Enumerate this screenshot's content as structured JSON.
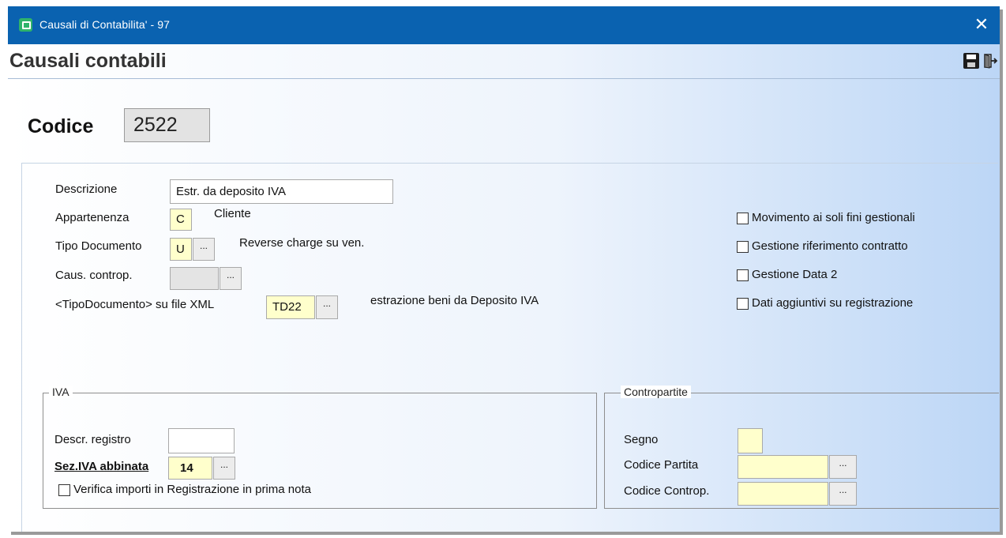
{
  "window": {
    "title": "Causali di Contabilita' - 97",
    "close_symbol": "✕"
  },
  "page": {
    "title": "Causali contabili"
  },
  "toolbar": {
    "save_icon": "save-icon",
    "exit_icon": "exit-icon"
  },
  "codice": {
    "label": "Codice",
    "value": "2522"
  },
  "form": {
    "descrizione": {
      "label": "Descrizione",
      "value": "Estr. da deposito IVA"
    },
    "appartenenza": {
      "label": "Appartenenza",
      "value": "C",
      "description": "Cliente"
    },
    "tipo_documento": {
      "label": "Tipo Documento",
      "value": "U",
      "lookup": "...",
      "description": "Reverse charge su ven."
    },
    "caus_controp": {
      "label": "Caus. controp.",
      "value": "",
      "lookup": "..."
    },
    "tipo_documento_xml": {
      "label": "<TipoDocumento> su file XML",
      "value": "TD22",
      "lookup": "...",
      "description": "estrazione beni da Deposito IVA"
    }
  },
  "options": [
    {
      "label": "Movimento ai soli fini gestionali",
      "checked": false
    },
    {
      "label": "Gestione riferimento contratto",
      "checked": false
    },
    {
      "label": "Gestione Data 2",
      "checked": false
    },
    {
      "label": "Dati aggiuntivi su registrazione",
      "checked": false
    }
  ],
  "iva": {
    "title": "IVA",
    "descr_registro": {
      "label": "Descr. registro",
      "value": ""
    },
    "sez_iva_abbinata": {
      "label": "Sez.IVA abbinata",
      "value": "14",
      "lookup": "..."
    },
    "verifica": {
      "label": "Verifica importi in Registrazione in prima nota",
      "checked": false
    }
  },
  "contropartite": {
    "title": "Contropartite",
    "segno": {
      "label": "Segno",
      "value": ""
    },
    "codice_partita": {
      "label": "Codice Partita",
      "value": "",
      "lookup": "..."
    },
    "codice_controp": {
      "label": "Codice Controp.",
      "value": "",
      "lookup": "..."
    }
  }
}
